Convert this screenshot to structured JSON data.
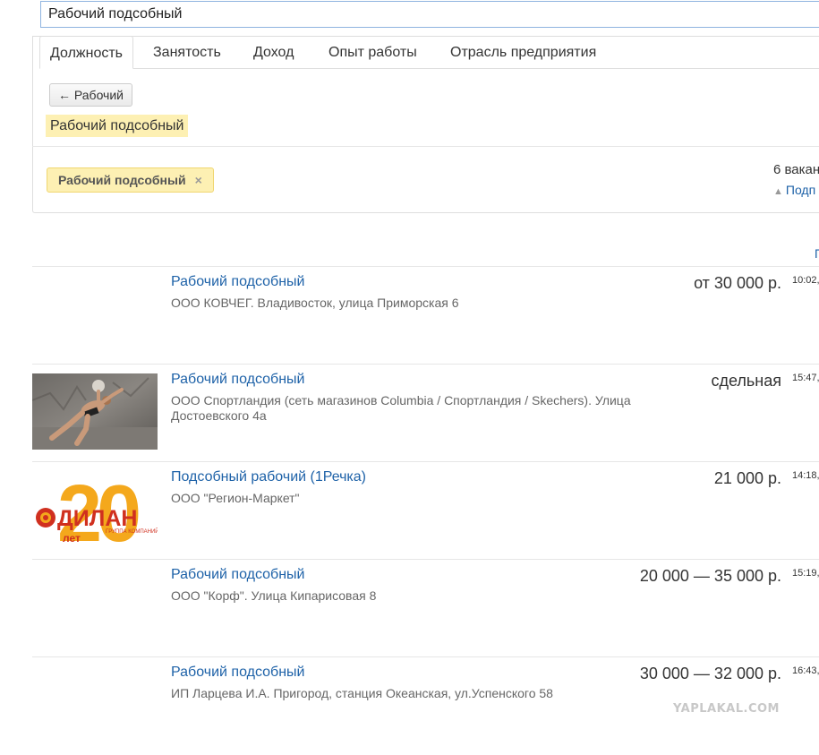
{
  "search": {
    "value": "Рабочий подсобный"
  },
  "tabs": [
    {
      "label": "Должность",
      "active": true
    },
    {
      "label": "Занятость",
      "active": false
    },
    {
      "label": "Доход",
      "active": false
    },
    {
      "label": "Опыт работы",
      "active": false
    },
    {
      "label": "Отрасль предприятия",
      "active": false
    }
  ],
  "filter": {
    "back_label": "← Рабочий",
    "current_label": "Рабочий подсобный",
    "chip_label": "Рабочий подсобный",
    "chip_close": "×",
    "count_text": "6 вакан",
    "subscribe_text": "Подп"
  },
  "sort_link": "П",
  "vacancies": [
    {
      "title": "Рабочий подсобный",
      "company": "ООО КОВЧЕГ. Владивосток, улица Приморская 6",
      "salary": "от 30 000 р.",
      "time": "10:02,",
      "thumb": "none"
    },
    {
      "title": "Рабочий подсобный",
      "company": "ООО Спортландия (сеть магазинов Columbia / Спортландия / Skechers). Улица Достоевского 4а",
      "salary": "сдельная",
      "time": "15:47,",
      "thumb": "photo"
    },
    {
      "title": "Подсобный рабочий (1Речка)",
      "company": "ООО \"Регион-Маркет\"",
      "salary": "21 000 р.",
      "time": "14:18,",
      "thumb": "logo"
    },
    {
      "title": "Рабочий подсобный",
      "company": "ООО \"Корф\". Улица Кипарисовая 8",
      "salary": "20 000 — 35 000 р.",
      "time": "15:19,",
      "thumb": "none"
    },
    {
      "title": "Рабочий подсобный",
      "company": "ИП Ларцева И.А. Пригород, станция Океанская, ул.Успенского 58",
      "salary": "30 000 — 32 000 р.",
      "time": "16:43,",
      "thumb": "none"
    }
  ],
  "logo": {
    "number": "20",
    "brand": "ДИЛАН",
    "sub": "ГРУППА КОМПАНИЙ",
    "years": "лет"
  },
  "watermark": "YAPLAKAL.COM",
  "colors": {
    "link": "#1e62a8",
    "highlight": "#fdf0b3",
    "logo_orange": "#f4a81c",
    "logo_red": "#d0301f"
  }
}
